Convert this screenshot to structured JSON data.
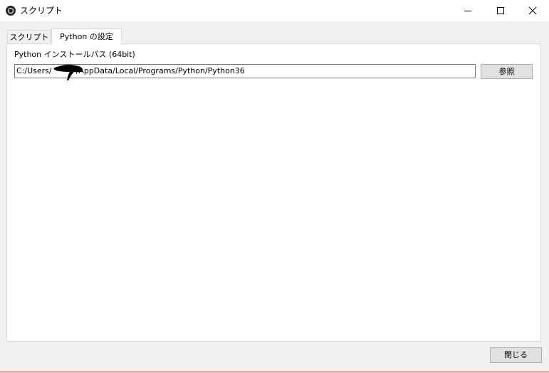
{
  "window": {
    "title": "スクリプト",
    "app_icon": "obs-icon",
    "controls": {
      "minimize_icon": "minimize-icon",
      "maximize_icon": "maximize-icon",
      "close_icon": "close-icon"
    }
  },
  "tabs": [
    {
      "label": "スクリプト",
      "active": false
    },
    {
      "label": "Python の設定",
      "active": true
    }
  ],
  "python_settings": {
    "install_path_label": "Python インストールパス (64bit)",
    "install_path_before": "C:/Users/",
    "install_path_after": "/AppData/Local/Programs/Python/Python36",
    "browse_button": "参照"
  },
  "footer": {
    "close_button": "閉じる"
  },
  "colors": {
    "titlebar": "#ffffff",
    "window_bg": "#f0f0f0",
    "panel_bg": "#ffffff",
    "button_bg": "#e1e1e1",
    "button_border": "#adadad",
    "input_border": "#7a7a7a",
    "bottom_accent": "#d84a4a"
  }
}
